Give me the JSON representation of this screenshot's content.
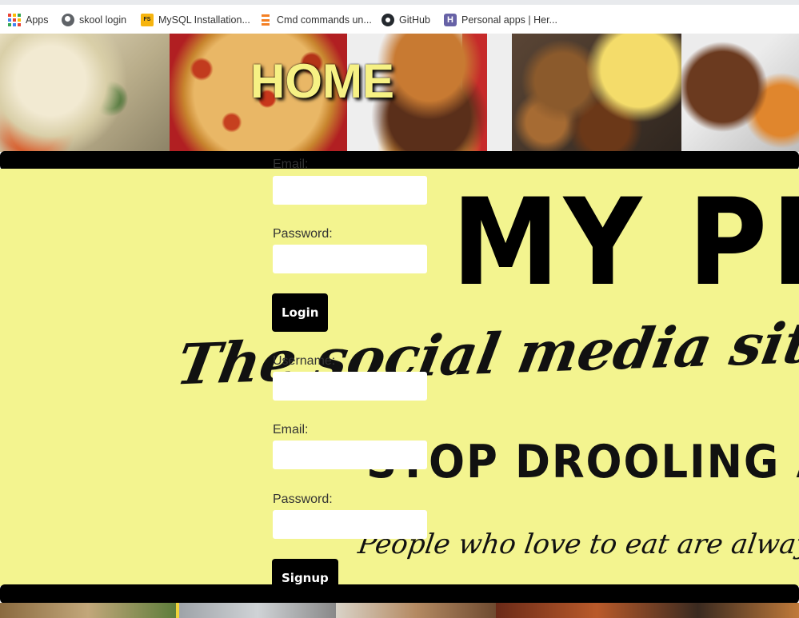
{
  "bookmarks": [
    {
      "label": "Apps",
      "icon": "apps-grid-icon"
    },
    {
      "label": "skool login",
      "icon": "globe-icon"
    },
    {
      "label": "MySQL Installation...",
      "icon": "fs-icon"
    },
    {
      "label": "Cmd commands un...",
      "icon": "stackoverflow-icon"
    },
    {
      "label": "GitHub",
      "icon": "github-icon"
    },
    {
      "label": "Personal apps | Her...",
      "icon": "heroku-icon"
    }
  ],
  "header": {
    "title": "HOME"
  },
  "hero": {
    "big_text": "MY PL",
    "script_text": "The social media site t",
    "stop_text": "STOP DROOLING AND",
    "quote_text": "People who love to eat are always the"
  },
  "login_form": {
    "email_label": "Email:",
    "email_value": "",
    "password_label": "Password:",
    "password_value": "",
    "submit_label": "Login"
  },
  "signup_form": {
    "username_label": "Username:",
    "username_value": "",
    "email_label": "Email:",
    "email_value": "",
    "password_label": "Password:",
    "password_value": "",
    "submit_label": "Signup"
  },
  "colors": {
    "accent_yellow": "#f3f48f",
    "title_yellow": "#f6f184",
    "button_black": "#000000"
  }
}
